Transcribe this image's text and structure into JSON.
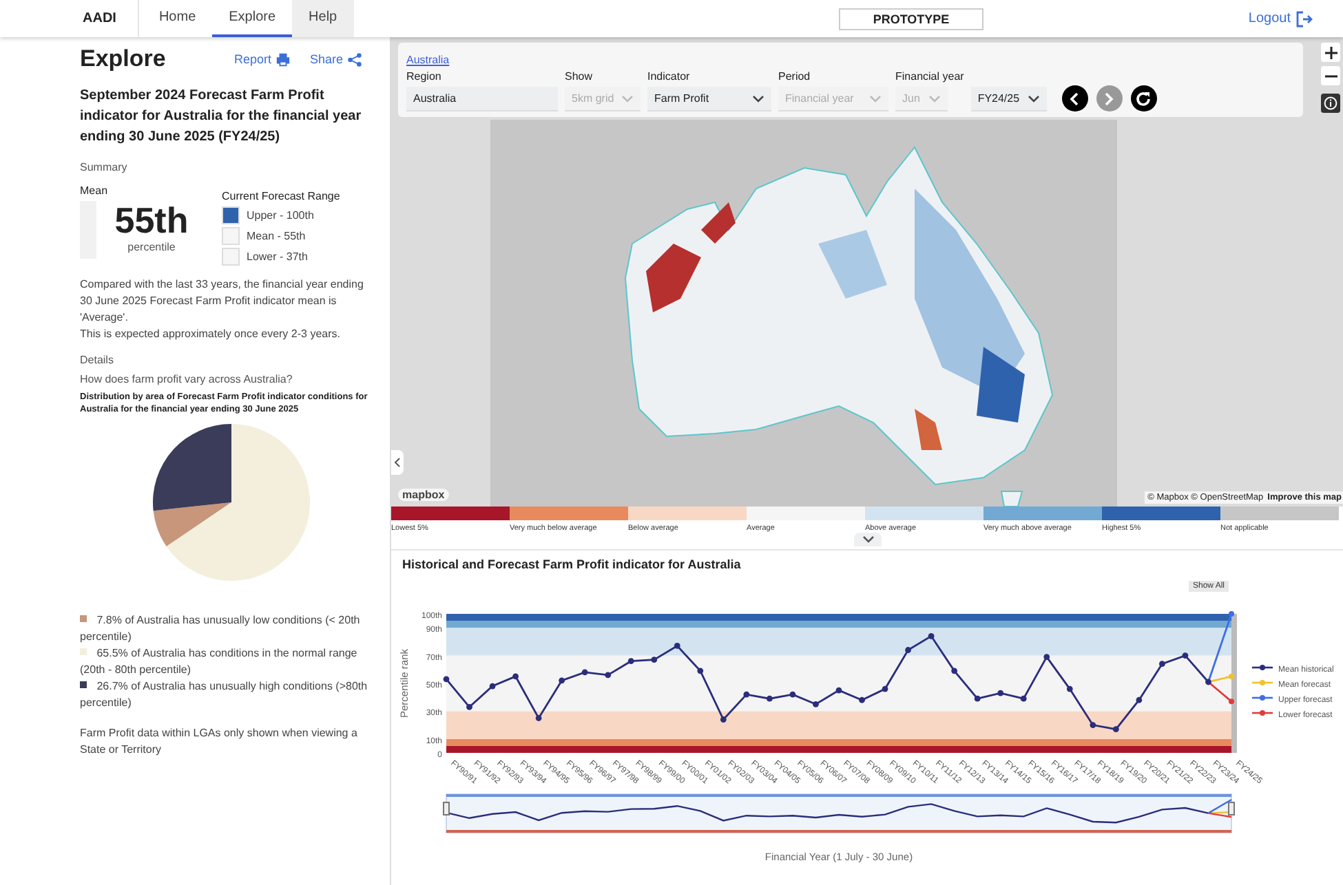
{
  "nav": {
    "brand": "AADI",
    "tabs": [
      {
        "label": "Home",
        "selected": false
      },
      {
        "label": "Explore",
        "selected": true
      },
      {
        "label": "Help",
        "selected": false
      }
    ],
    "badge": "PROTOTYPE",
    "logout": "Logout"
  },
  "panel": {
    "title": "Explore",
    "actions": [
      {
        "label": "Report",
        "kind": "print"
      },
      {
        "label": "Share",
        "kind": "share"
      }
    ],
    "heading": "September 2024 Forecast Farm Profit indicator for Australia for the financial year ending 30 June 2025 (FY24/25)",
    "summary_label": "Summary",
    "mean_label": "Mean",
    "mean_value": "55th",
    "mean_unit": "percentile",
    "range_title": "Current Forecast Range",
    "range": [
      {
        "label": "Upper - 100th",
        "color": "#2f62ad"
      },
      {
        "label": "Mean - 55th",
        "color": "#f6f6f6"
      },
      {
        "label": "Lower - 37th",
        "color": "#f6f6f6"
      }
    ],
    "paragraphs": [
      "Compared with the last 33 years, the financial year ending 30 June 2025 Forecast Farm Profit indicator mean is 'Average'.",
      "This is expected approximately once every 2-3 years."
    ],
    "details_label": "Details",
    "question": "How does farm profit vary across Australia?",
    "chart_data": {
      "type": "pie",
      "title": "Distribution by area of Forecast Farm Profit indicator conditions for Australia for the financial year ending 30 June 2025",
      "categories": [
        "7.8% of Australia has unusually low conditions (< 20th percentile)",
        "65.5% of Australia has conditions in the normal range (20th - 80th percentile)",
        "26.7% of Australia has unusually high conditions (>80th percentile)"
      ],
      "values": [
        7.8,
        65.5,
        26.7
      ],
      "colors": [
        "#c8967a",
        "#f3efdc",
        "#3b3b5a"
      ]
    },
    "note": "Farm Profit data within LGAs only shown when viewing a State or Territory"
  },
  "map": {
    "breadcrumb": "Australia",
    "controls": [
      {
        "label": "Region",
        "kind": "input",
        "value": "Australia",
        "disabled": false
      },
      {
        "label": "Show",
        "kind": "select",
        "value": "5km grid",
        "disabled": true
      },
      {
        "label": "Indicator",
        "kind": "select",
        "value": "Farm Profit",
        "disabled": false
      },
      {
        "label": "Period",
        "kind": "select",
        "value": "Financial year",
        "disabled": true
      },
      {
        "label": "Financial year",
        "kind": "select",
        "value": "Jun",
        "disabled": true
      },
      {
        "kind": "select",
        "value": "FY24/25",
        "disabled": false
      }
    ],
    "buttons": [
      {
        "kind": "prev",
        "disabled": false
      },
      {
        "kind": "next",
        "disabled": true
      },
      {
        "kind": "refresh",
        "disabled": false
      }
    ],
    "logo": "mapbox",
    "attribution": "© Mapbox © OpenStreetMap",
    "improve": "Improve this map",
    "legend": [
      {
        "label": "Lowest 5%",
        "color": "#a8162a"
      },
      {
        "label": "Very much below average",
        "color": "#e88a5e"
      },
      {
        "label": "Below average",
        "color": "#f8d8c4"
      },
      {
        "label": "Average",
        "color": "#f5f5f5"
      },
      {
        "label": "Above average",
        "color": "#d3e4f0"
      },
      {
        "label": "Very much above average",
        "color": "#72a9d2"
      },
      {
        "label": "Highest 5%",
        "color": "#2f62ad"
      },
      {
        "label": "Not applicable",
        "color": "#c6c6c6"
      }
    ]
  },
  "history": {
    "expanded": true,
    "title": "Historical and Forecast Farm Profit indicator for Australia",
    "show_all": "Show All",
    "chart_data": {
      "type": "line",
      "xlabel": "Financial Year (1 July - 30 June)",
      "ylabel": "Percentile rank",
      "categories": [
        "FY90/91",
        "FY91/92",
        "FY92/93",
        "FY93/94",
        "FY94/95",
        "FY95/96",
        "FY96/97",
        "FY97/98",
        "FY98/99",
        "FY99/00",
        "FY00/01",
        "FY01/02",
        "FY02/03",
        "FY03/04",
        "FY04/05",
        "FY05/06",
        "FY06/07",
        "FY07/08",
        "FY08/09",
        "FY09/10",
        "FY10/11",
        "FY11/12",
        "FY12/13",
        "FY13/14",
        "FY14/15",
        "FY15/16",
        "FY16/17",
        "FY17/18",
        "FY18/19",
        "FY19/20",
        "FY20/21",
        "FY21/22",
        "FY22/23",
        "FY23/24",
        "FY24/25"
      ],
      "ylim": [
        0,
        100
      ],
      "legend": true,
      "bands": [
        {
          "axis": "y",
          "from": 0,
          "to": 5,
          "color": "#a8162a"
        },
        {
          "axis": "y",
          "from": 5,
          "to": 10,
          "color": "#e88a5e"
        },
        {
          "axis": "y",
          "from": 10,
          "to": 30,
          "color": "#f8d8c4"
        },
        {
          "axis": "y",
          "from": 30,
          "to": 70,
          "color": "#f4f4f4"
        },
        {
          "axis": "y",
          "from": 70,
          "to": 90,
          "color": "#d3e4f0"
        },
        {
          "axis": "y",
          "from": 90,
          "to": 95,
          "color": "#72a9d2"
        },
        {
          "axis": "y",
          "from": 95,
          "to": 100,
          "color": "#2f62ad"
        }
      ],
      "yticks": [
        {
          "value": 0,
          "label": "0"
        },
        {
          "value": 10,
          "label": "10th"
        },
        {
          "value": 30,
          "label": "30th"
        },
        {
          "value": 50,
          "label": "50th"
        },
        {
          "value": 70,
          "label": "70th"
        },
        {
          "value": 90,
          "label": "90th"
        },
        {
          "value": 100,
          "label": "100th"
        }
      ],
      "series": [
        {
          "name": "Mean historical",
          "color": "#2b2d7c",
          "marker": "circle",
          "values": [
            53,
            33,
            48,
            55,
            25,
            52,
            58,
            56,
            66,
            67,
            77,
            59,
            24,
            42,
            39,
            42,
            35,
            45,
            38,
            46,
            74,
            84,
            59,
            39,
            43,
            39,
            69,
            46,
            20,
            17,
            38,
            64,
            70,
            51,
            null
          ]
        },
        {
          "name": "Mean forecast",
          "color": "#f2c12e",
          "marker": "circle",
          "values": [
            null,
            null,
            null,
            null,
            null,
            null,
            null,
            null,
            null,
            null,
            null,
            null,
            null,
            null,
            null,
            null,
            null,
            null,
            null,
            null,
            null,
            null,
            null,
            null,
            null,
            null,
            null,
            null,
            null,
            null,
            null,
            null,
            null,
            51,
            55
          ]
        },
        {
          "name": "Upper forecast",
          "color": "#3d6ee8",
          "marker": "circle",
          "values": [
            null,
            null,
            null,
            null,
            null,
            null,
            null,
            null,
            null,
            null,
            null,
            null,
            null,
            null,
            null,
            null,
            null,
            null,
            null,
            null,
            null,
            null,
            null,
            null,
            null,
            null,
            null,
            null,
            null,
            null,
            null,
            null,
            null,
            51,
            100
          ]
        },
        {
          "name": "Lower forecast",
          "color": "#e23a3a",
          "marker": "circle",
          "values": [
            null,
            null,
            null,
            null,
            null,
            null,
            null,
            null,
            null,
            null,
            null,
            null,
            null,
            null,
            null,
            null,
            null,
            null,
            null,
            null,
            null,
            null,
            null,
            null,
            null,
            null,
            null,
            null,
            null,
            null,
            null,
            null,
            null,
            51,
            37
          ]
        }
      ]
    }
  }
}
